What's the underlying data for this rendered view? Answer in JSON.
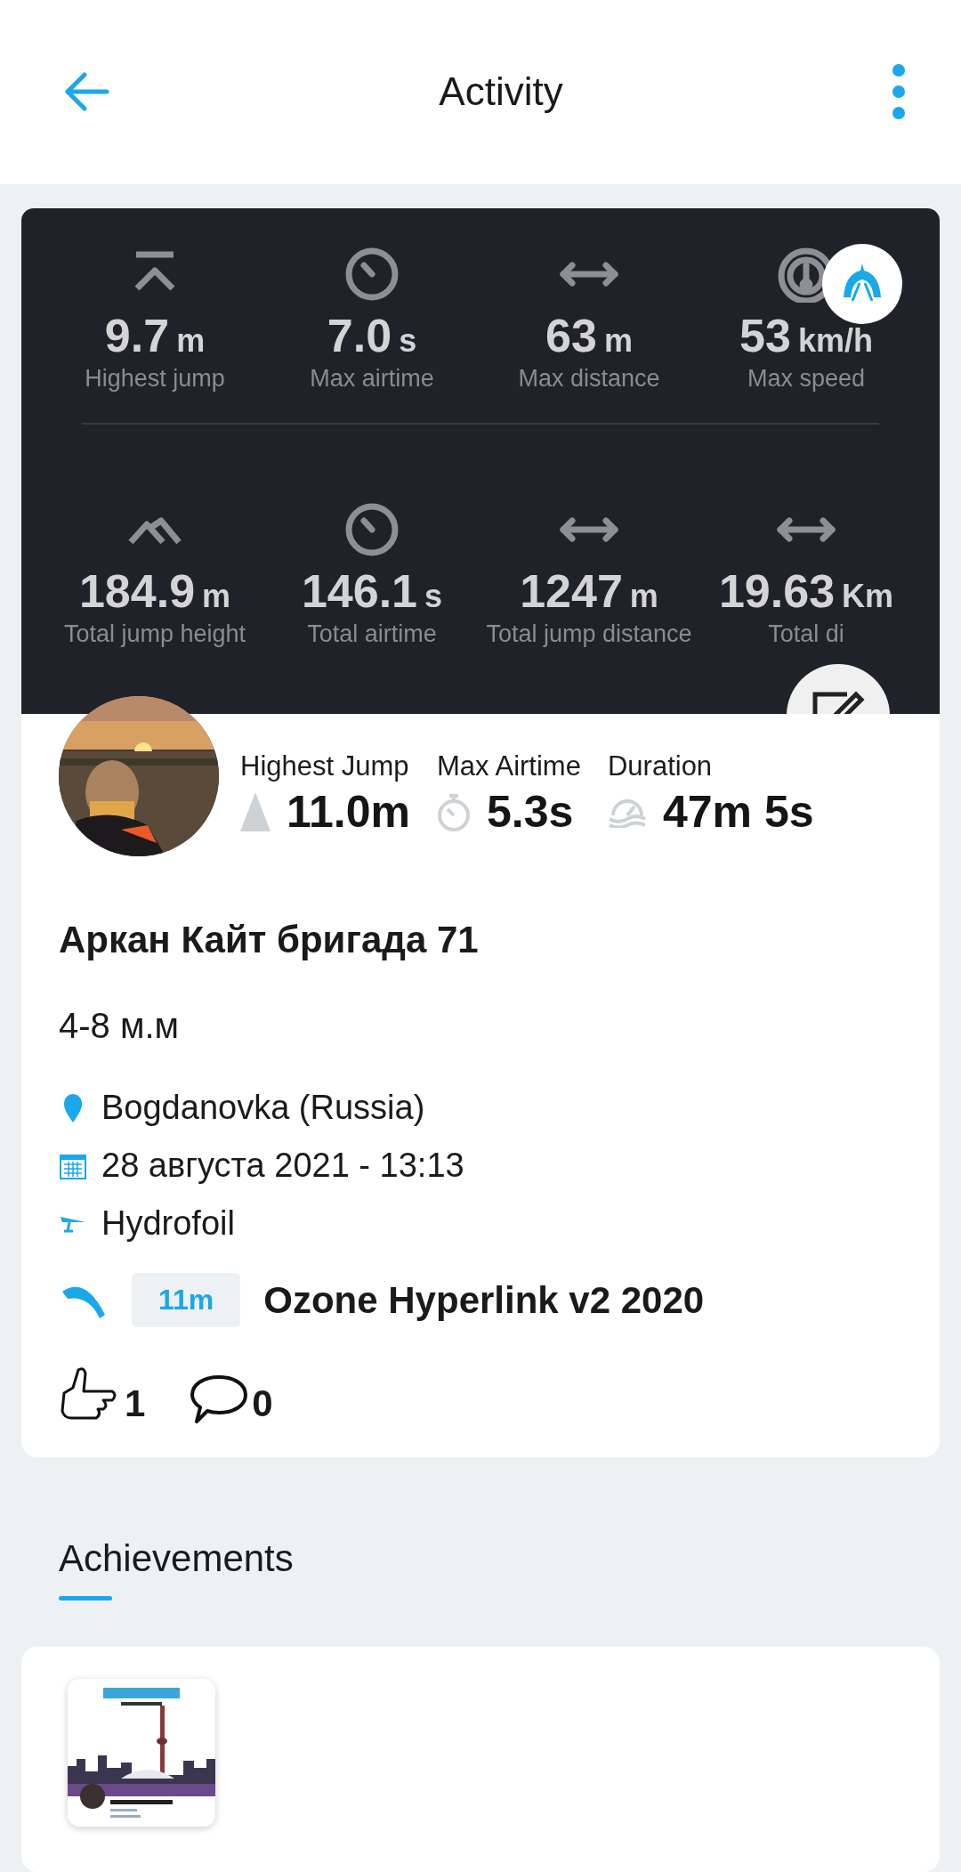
{
  "header": {
    "title": "Activity"
  },
  "stats_panel": {
    "rows": [
      [
        {
          "kind": "jump",
          "value": "9.7",
          "unit": "m",
          "label": "Highest jump"
        },
        {
          "kind": "timer",
          "value": "7.0",
          "unit": "s",
          "label": "Max airtime"
        },
        {
          "kind": "distance",
          "value": "63",
          "unit": "m",
          "label": "Max distance"
        },
        {
          "kind": "speed",
          "value": "53",
          "unit": "km/h",
          "label": "Max speed"
        }
      ],
      [
        {
          "kind": "peaks",
          "value": "184.9",
          "unit": "m",
          "label": "Total jump height"
        },
        {
          "kind": "timer",
          "value": "146.1",
          "unit": "s",
          "label": "Total airtime"
        },
        {
          "kind": "distance",
          "value": "1247",
          "unit": "m",
          "label": "Total jump distance"
        },
        {
          "kind": "distance",
          "value": "19.63",
          "unit": "Km",
          "label": "Total di"
        }
      ]
    ]
  },
  "session": {
    "stats": [
      {
        "kind": "peak",
        "label": "Highest Jump",
        "value": "11.0m"
      },
      {
        "kind": "stopwatch",
        "label": "Max Airtime",
        "value": "5.3s"
      },
      {
        "kind": "gauge",
        "label": "Duration",
        "value": "47m 5s"
      }
    ],
    "title": "Аркан Кайт бригада 71",
    "subtitle": "4-8 м.м",
    "details": [
      {
        "kind": "location",
        "text": "Bogdanovka (Russia)"
      },
      {
        "kind": "date",
        "text": "28 августа 2021 - 13:13"
      },
      {
        "kind": "hydrofoil",
        "text": "Hydrofoil"
      }
    ],
    "kite": {
      "size": "11m",
      "name": "Ozone Hyperlink v2 2020"
    },
    "likes": "1",
    "comments": "0"
  },
  "achievements": {
    "title": "Achievements"
  }
}
